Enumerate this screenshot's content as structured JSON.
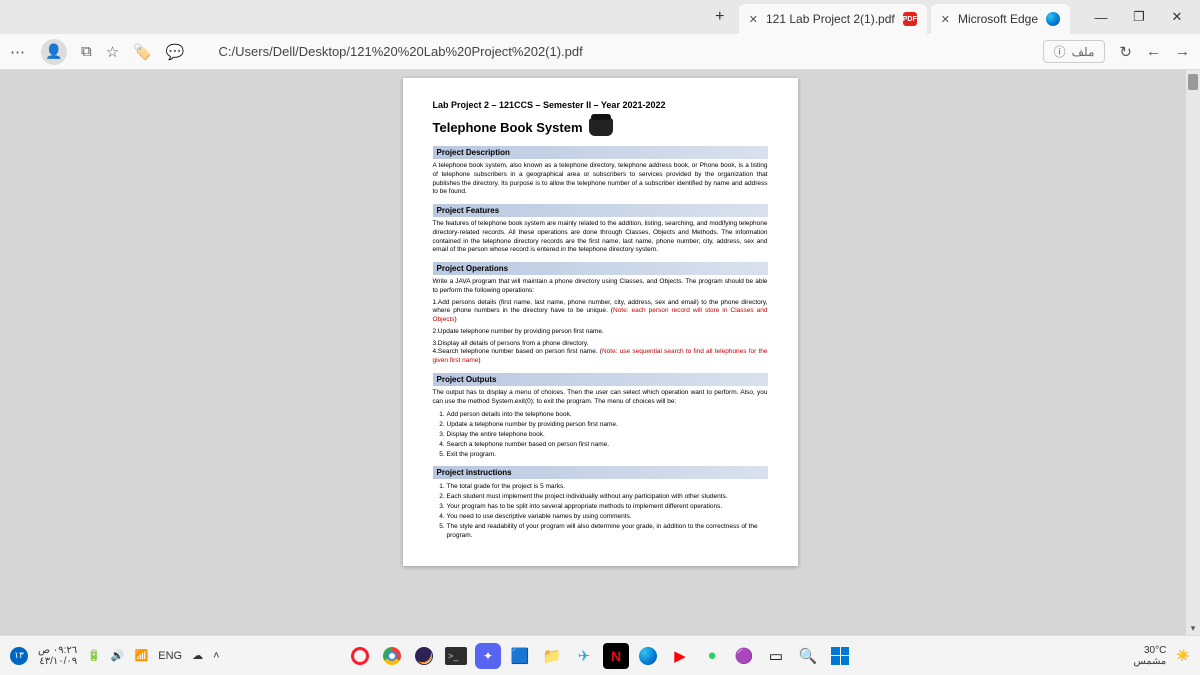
{
  "tabs": {
    "edge": "Microsoft Edge",
    "pdf": "121 Lab Project 2(1).pdf"
  },
  "addr": {
    "url": "C:/Users/Dell/Desktop/121%20%20Lab%20Project%202(1).pdf",
    "file_label": "ملف"
  },
  "doc": {
    "header": "Lab Project 2 – 121CCS – Semester II – Year 2021-2022",
    "title": "Telephone Book System",
    "sections": {
      "desc_h": "Project Description",
      "desc_p": "A telephone book system, also known as a telephone directory, telephone address book, or Phone book, is a listing of telephone subscribers in a geographical area or subscribers to services provided by the organization that publishes the directory. Its purpose is to allow the telephone number of a subscriber identified by name and address to be found.",
      "feat_h": "Project Features",
      "feat_p": "The features of telephone book system are mainly related to the addition, listing, searching, and modifying telephone directory-related records. All these operations are done through Classes, Objects and Methods. The information contained in the telephone directory records are the first name, last name, phone number, city, address, sex and email of the person whose record is entered in the telephone directory system.",
      "ops_h": "Project Operations",
      "ops_p1": "Write a JAVA program that will maintain a phone directory using Classes, and Objects. The program should be able to perform the following operations:",
      "ops_1a": "1.Add persons details (first name, last name, phone number, city, address, sex and email) to the phone directory, where phone numbers in the directory have to be unique. (",
      "ops_1b": "Note: each person record will store in Classes and Objects",
      "ops_1c": ")",
      "ops_2": "2.Update telephone number by providing person first name.",
      "ops_3": "3.Display all details of persons from a phone directory.",
      "ops_4a": "4.Search telephone number based on person first name. (",
      "ops_4b": "Note: use sequential search to find all telephones for the given first name",
      "ops_4c": ")",
      "out_h": "Project Outputs",
      "out_p": "The output has to display a menu of choices. Then the user can select which operation want to perform. Also, you can use the method System.exit(0); to exit the program. The menu of choices will be:",
      "out_items": [
        "Add person details into the telephone book.",
        "Update a telephone number by providing person first name.",
        "Display the entire telephone book.",
        "Search a telephone number based on person first name.",
        "Exit the program."
      ],
      "inst_h": "Project instructions",
      "inst_items": [
        "The total grade for the project is 5 marks.",
        "Each student must implement the project individually without any participation with other students.",
        "Your program has to be split into several appropriate methods to implement different operations.",
        "You need to use descriptive variable names by using comments.",
        "The style and readability of your program will also determine your grade, in addition to the correctness of the program."
      ]
    }
  },
  "taskbar": {
    "lang": "ENG",
    "time": "٠٩:٢٦ ص",
    "date": "٤٣/١٠/٠٩",
    "notif": "١٣",
    "temp": "30°C",
    "weather": "مشمس"
  }
}
